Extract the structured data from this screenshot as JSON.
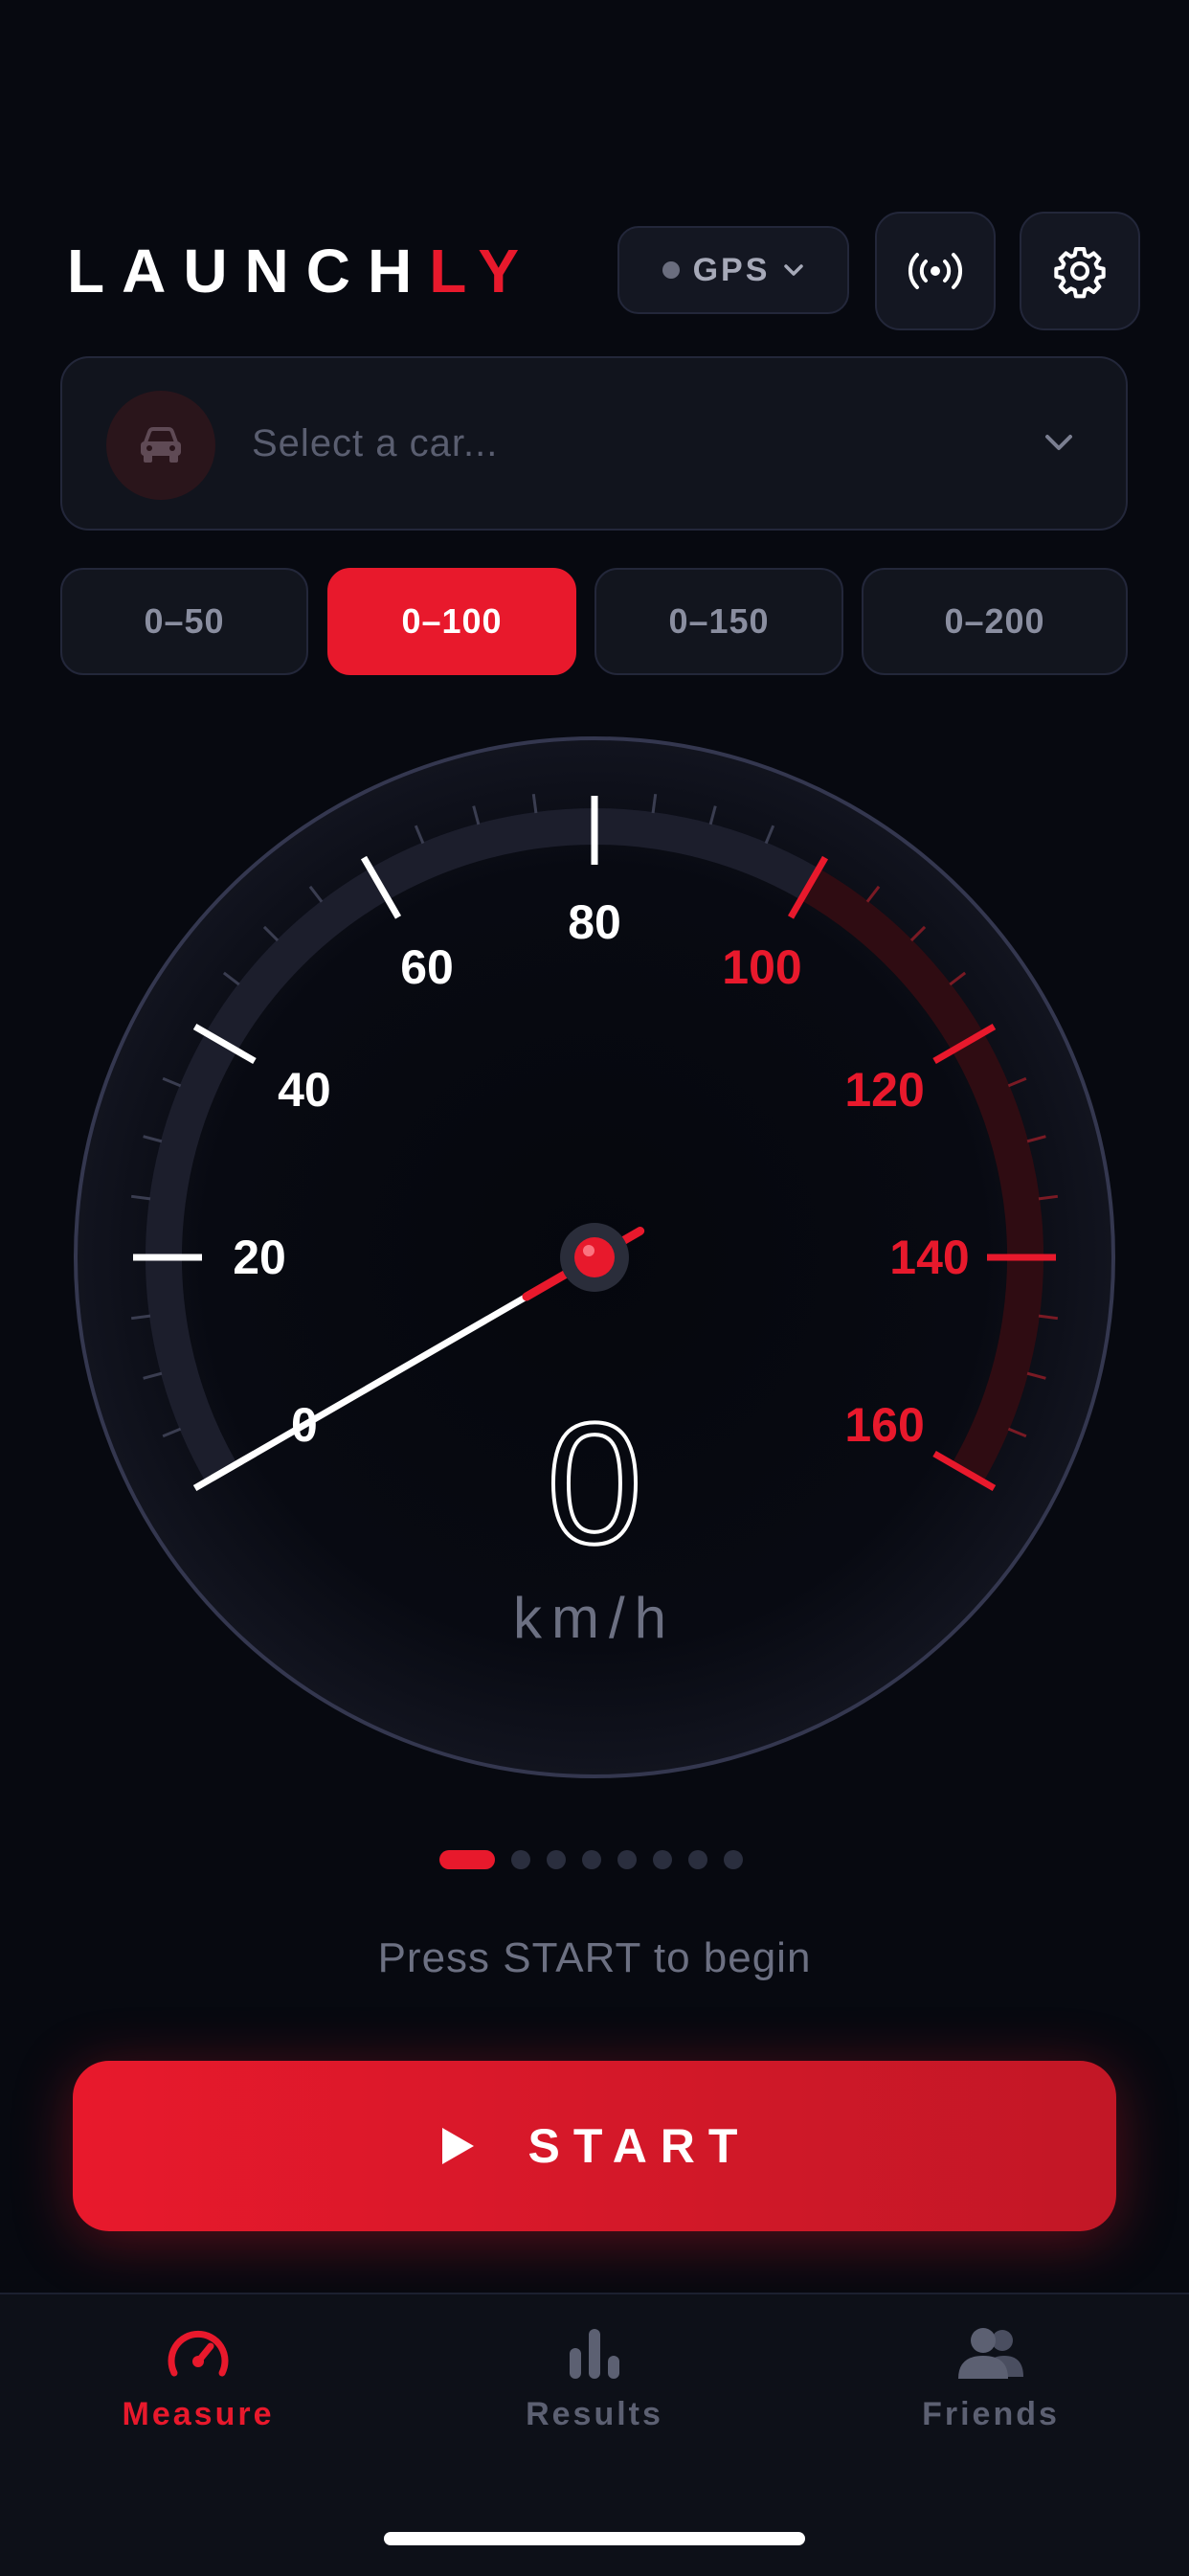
{
  "app": {
    "logo_part1": "LAUNCH",
    "logo_part2": "LY",
    "accent": "#e8192c"
  },
  "header": {
    "gps_label": "GPS",
    "gps_icon": "chevron-down-icon",
    "broadcast_icon": "broadcast-icon",
    "settings_icon": "gear-icon"
  },
  "car_selector": {
    "placeholder": "Select a car...",
    "icon": "car-icon"
  },
  "ranges": [
    {
      "label": "0–50",
      "active": false
    },
    {
      "label": "0–100",
      "active": true
    },
    {
      "label": "0–150",
      "active": false
    },
    {
      "label": "0–200",
      "active": false
    }
  ],
  "gauge": {
    "min": 0,
    "max": 160,
    "target": 100,
    "needle_value": 0,
    "labels": [
      "0",
      "20",
      "40",
      "60",
      "80",
      "100",
      "120",
      "140",
      "160"
    ],
    "speed": "0",
    "unit": "km/h"
  },
  "pager": {
    "count": 8,
    "active": 0
  },
  "status": {
    "hint": "Press START to begin"
  },
  "start_button": {
    "label": "START",
    "icon": "play-icon"
  },
  "tabs": [
    {
      "label": "Measure",
      "icon": "speedometer-icon",
      "active": true
    },
    {
      "label": "Results",
      "icon": "bar-chart-icon",
      "active": false
    },
    {
      "label": "Friends",
      "icon": "users-icon",
      "active": false
    }
  ]
}
